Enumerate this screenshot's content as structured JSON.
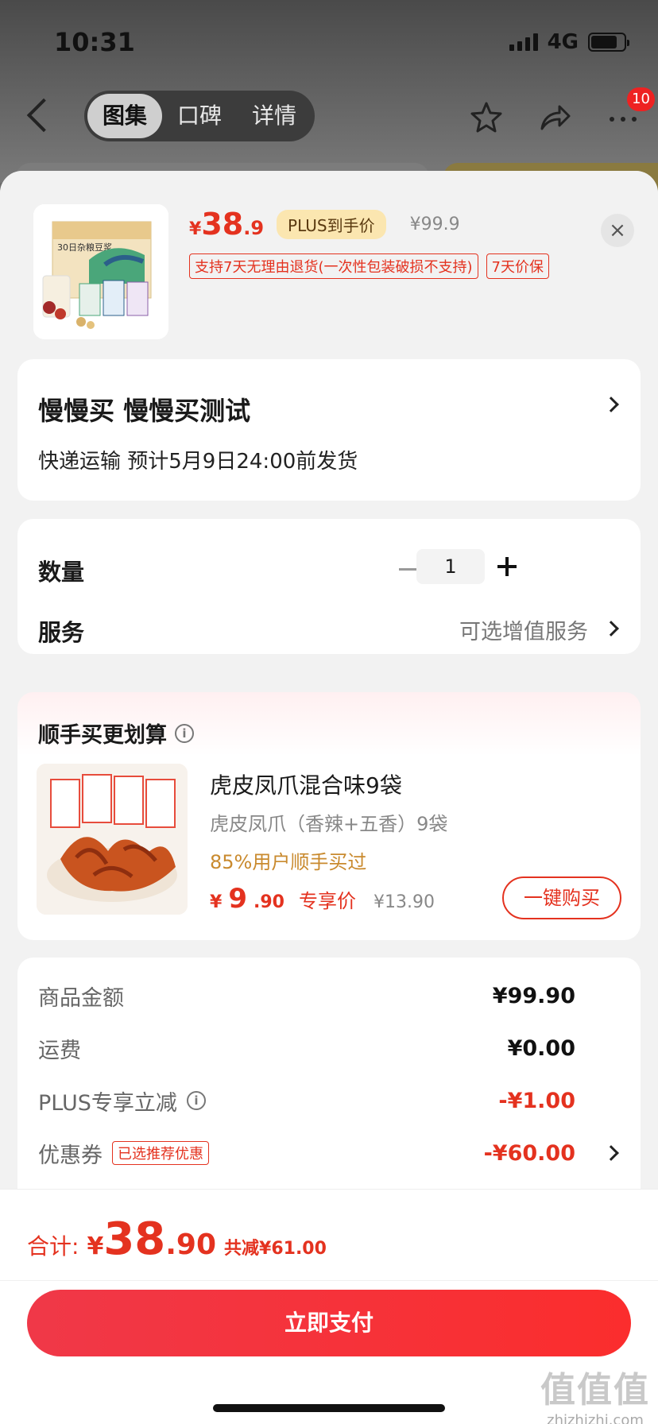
{
  "status_bar": {
    "time": "10:31",
    "network": "4G"
  },
  "nav": {
    "tabs": [
      {
        "label": "图集",
        "active": true
      },
      {
        "label": "口碑",
        "active": false
      },
      {
        "label": "详情",
        "active": false
      }
    ],
    "more_badge": "10"
  },
  "product": {
    "price_currency": "¥",
    "price_int": "38",
    "price_dec": ".9",
    "plus_tag": "PLUS到手价",
    "original_price": "¥99.9",
    "tags": [
      "支持7天无理由退货(一次性包装破损不支持)",
      "7天价保"
    ],
    "close_glyph": "×",
    "thumb_caption": "30日杂粮豆浆"
  },
  "address": {
    "name_line": "慢慢买  慢慢买测试",
    "shipping": "快递运输 预计5月9日24:00前发货"
  },
  "quantity": {
    "label": "数量",
    "value": "1",
    "service_label": "服务",
    "service_value": "可选增值服务"
  },
  "addon": {
    "title": "顺手买更划算",
    "info_glyph": "i",
    "item_name": "虎皮凤爪混合味9袋",
    "item_sub": "虎皮凤爪（香辣+五香）9袋",
    "item_note": "85%用户顺手买过",
    "price_currency": "¥",
    "price_int": "9",
    "price_dec": ".90",
    "price_tag": "专享价",
    "old_price": "¥13.90",
    "buy_label": "一键购买"
  },
  "summary": {
    "rows": [
      {
        "label": "商品金额",
        "value": "¥99.90"
      },
      {
        "label": "运费",
        "value": "¥0.00"
      },
      {
        "label": "PLUS专享立减",
        "value": "-¥1.00"
      },
      {
        "label": "优惠券",
        "tag": "已选推荐优惠",
        "value": "-¥60.00"
      }
    ]
  },
  "footer": {
    "total_label": "合计:",
    "total_currency": "¥",
    "total_int": "38",
    "total_dec": ".90",
    "saved": "共减¥61.00",
    "pay_label": "立即支付"
  },
  "watermark": {
    "big": "值值值",
    "small": "zhizhizhi.com"
  },
  "colors": {
    "accent_red": "#e4321f",
    "plus_gold": "#fbe6b0",
    "note_orange": "#c98a2e"
  }
}
